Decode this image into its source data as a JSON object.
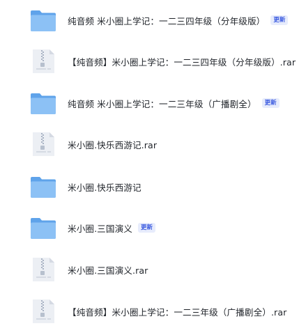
{
  "files": [
    {
      "type": "folder",
      "icon": "folder-icon",
      "name": "纯音频 米小圈上学记：一二三四年级（分年级版）",
      "badge": "更新"
    },
    {
      "type": "archive",
      "icon": "archive-file-icon",
      "name": "【纯音频】米小圈上学记：一二三四年级（分年级版）.rar"
    },
    {
      "type": "folder",
      "icon": "folder-icon",
      "name": "纯音频 米小圈上学记：一二三年级（广播剧全）",
      "badge": "更新"
    },
    {
      "type": "archive",
      "icon": "archive-file-icon",
      "name": "米小圈.快乐西游记.rar"
    },
    {
      "type": "folder",
      "icon": "folder-icon",
      "name": "米小圈.快乐西游记"
    },
    {
      "type": "folder",
      "icon": "folder-icon",
      "name": "米小圈.三国演义",
      "badge": "更新"
    },
    {
      "type": "archive",
      "icon": "archive-file-icon",
      "name": "米小圈.三国演义.rar"
    },
    {
      "type": "archive",
      "icon": "archive-file-icon",
      "name": "【纯音频】米小圈上学记：一二三年级（广播剧全）.rar"
    }
  ],
  "colors": {
    "folder_back": "#5fa3ea",
    "folder_front": "#8cc1f5",
    "archive_body": "#eceff4",
    "badge_bg": "#e7ecfc",
    "badge_text": "#3d5ce0",
    "text": "#1f2329"
  }
}
